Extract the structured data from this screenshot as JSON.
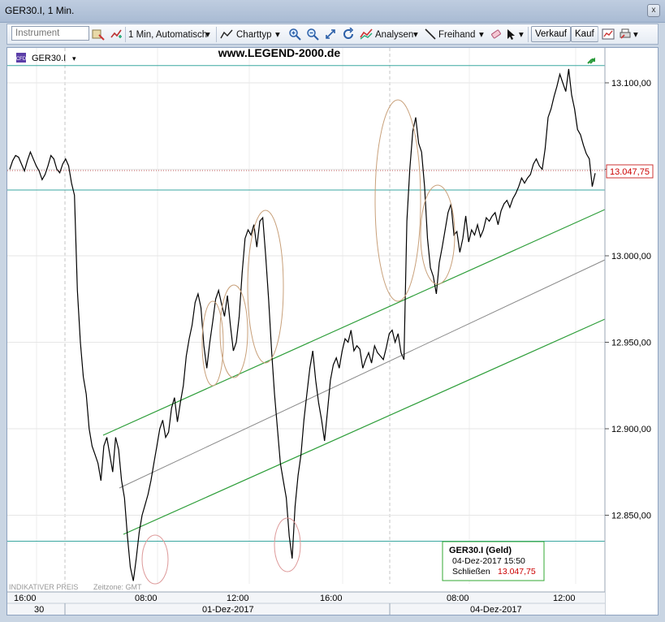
{
  "window": {
    "title": "GER30.I, 1 Min.",
    "close_label": "x"
  },
  "toolbar": {
    "instrument_placeholder": "Instrument",
    "interval_label": "1 Min,  Automatisch",
    "charttype_label": "Charttyp",
    "analysen_label": "Analysen",
    "freihand_label": "Freihand",
    "sell_label": "Verkauf",
    "buy_label": "Kauf"
  },
  "chart": {
    "symbol": "GER30.I",
    "watermark": "www.LEGEND-2000.de",
    "indicative_note": "INDIKATIVER PREIS",
    "timezone_note": "Zeitzone: GMT",
    "price_tag": "13.047,75",
    "tooltip": {
      "title": "GER30.I (Geld)",
      "datetime": "04-Dez-2017 15:50",
      "close_label": "Schließen",
      "close_value": "13.047,75"
    },
    "accent_color": "#cc0000",
    "line_color": "#000000",
    "trend_color": "#2e9e3a",
    "level_color": "#3aa7a0"
  },
  "chart_data": {
    "type": "line",
    "title": "GER30.I, 1 Min.",
    "y_ticks": [
      "13.100,00",
      "13.050,00",
      "13.000,00",
      "12.950,00",
      "12.900,00",
      "12.850,00"
    ],
    "ylim": [
      12810,
      13125
    ],
    "x_time_ticks": [
      "16:00",
      "08:00",
      "12:00",
      "16:00",
      "08:00",
      "12:00"
    ],
    "x_date_ticks": [
      "30",
      "01-Dez-2017",
      "04-Dez-2017"
    ],
    "last_value": 13047.75,
    "horizontal_levels": [
      13110,
      13038,
      12835
    ],
    "series": [
      {
        "values": [
          13050,
          13055,
          13058,
          13057,
          13053,
          13049,
          13055,
          13060,
          13056,
          13052,
          13049,
          13044,
          13047,
          13052,
          13058,
          13056,
          13050,
          13048,
          13053,
          13056,
          13052,
          13042,
          13035,
          12980,
          12950,
          12930,
          12920,
          12900,
          12890,
          12885,
          12880,
          12870,
          12890,
          12895,
          12885,
          12875,
          12895,
          12888,
          12870,
          12860,
          12838,
          12820,
          12812,
          12825,
          12840,
          12850,
          12856,
          12862,
          12870,
          12880,
          12890,
          12900,
          12905,
          12895,
          12898,
          12912,
          12918,
          12904,
          12915,
          12925,
          12942,
          12952,
          12960,
          12973,
          12978,
          12970,
          12948,
          12935,
          12950,
          12962,
          12975,
          12980,
          12972,
          12965,
          12977,
          12960,
          12945,
          12950,
          12965,
          12990,
          13010,
          13015,
          13012,
          13018,
          13005,
          13020,
          13022,
          13000,
          12975,
          12945,
          12920,
          12900,
          12880,
          12870,
          12860,
          12838,
          12825,
          12855,
          12873,
          12885,
          12905,
          12920,
          12935,
          12945,
          12928,
          12915,
          12905,
          12893,
          12910,
          12928,
          12937,
          12941,
          12935,
          12945,
          12952,
          12950,
          12957,
          12945,
          12948,
          12946,
          12935,
          12940,
          12944,
          12938,
          12948,
          12944,
          12942,
          12940,
          12947,
          12955,
          12957,
          12950,
          12955,
          12944,
          12940,
          13020,
          13050,
          13072,
          13080,
          13065,
          13060,
          13040,
          13010,
          12993,
          12988,
          12978,
          12996,
          13005,
          13015,
          13025,
          13030,
          13012,
          13014,
          13002,
          13010,
          13023,
          13008,
          13015,
          13012,
          13018,
          13011,
          13015,
          13022,
          13020,
          13023,
          13025,
          13018,
          13026,
          13030,
          13032,
          13028,
          13033,
          13036,
          13040,
          13045,
          13042,
          13045,
          13047,
          13053,
          13056,
          13052,
          13050,
          13062,
          13080,
          13085,
          13092,
          13098,
          13105,
          13100,
          13095,
          13108,
          13093,
          13085,
          13073,
          13070,
          13064,
          13059,
          13056,
          13040,
          13047.75
        ]
      }
    ]
  }
}
